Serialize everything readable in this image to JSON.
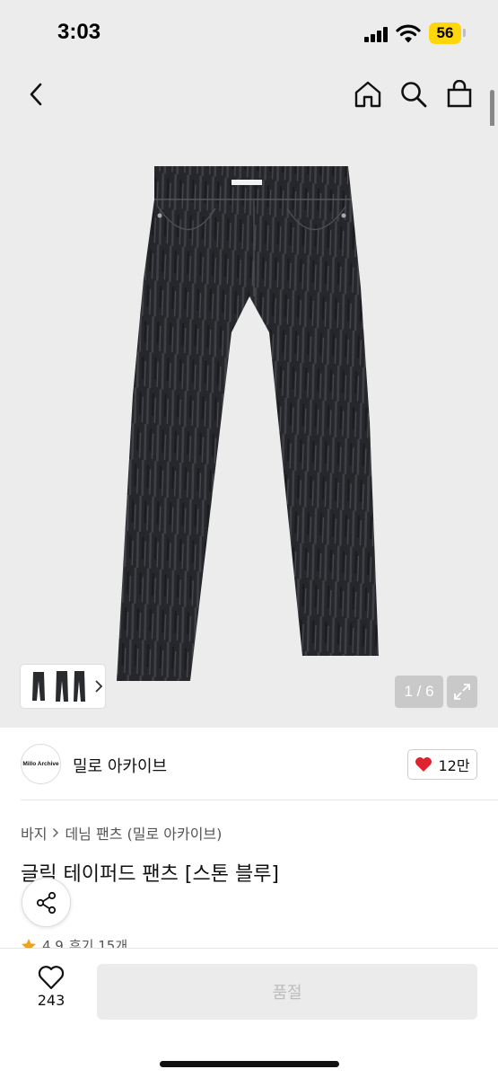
{
  "status_bar": {
    "time": "3:03",
    "battery": "56",
    "battery_color": "#ffd60a"
  },
  "nav": {
    "icons": [
      "back-chevron-icon",
      "home-icon",
      "search-icon",
      "shopping-bag-icon"
    ]
  },
  "gallery": {
    "counter": "1 / 6",
    "current": 1,
    "total": 6
  },
  "brand": {
    "logo_text": "Millo Archive",
    "name": "밀로 아카이브",
    "likes": "12만",
    "heart_color": "#e0242f"
  },
  "breadcrumb": [
    "바지",
    "데님 팬츠 (밀로 아카이브)"
  ],
  "product": {
    "title": "글릭 테이퍼드 팬츠 [스톤 블루]",
    "rating": "4.9",
    "reviews": "후기 15개",
    "star_color": "#f2a11c"
  },
  "bottom": {
    "wish_count": "243",
    "buy_label": "품절"
  }
}
